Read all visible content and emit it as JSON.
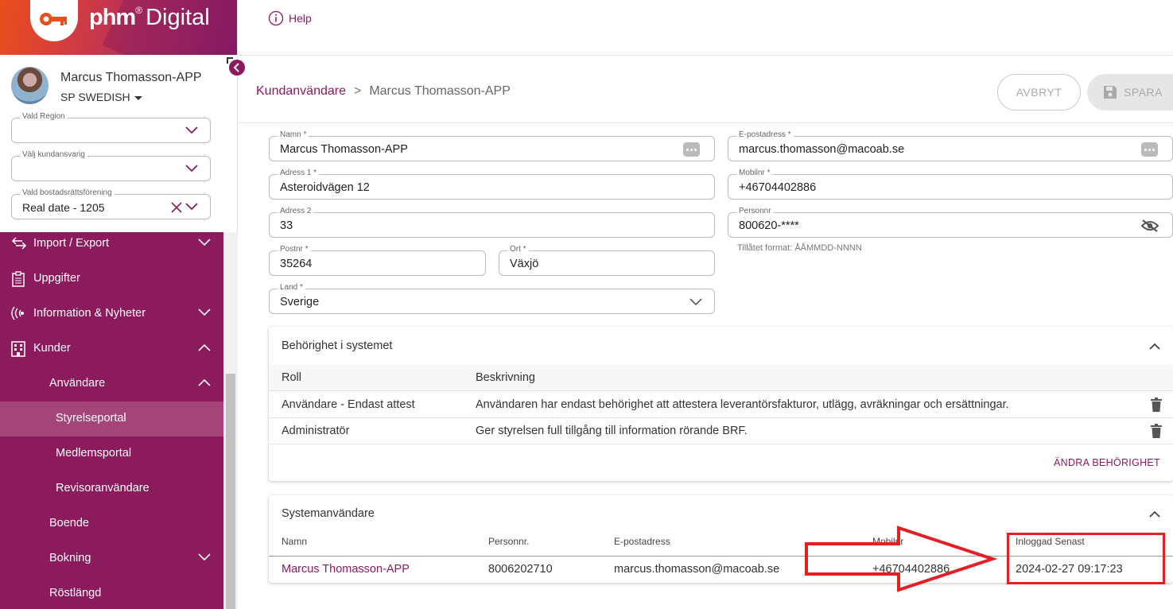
{
  "brand": {
    "name": "phm",
    "suffix": "Digital",
    "sup": "®"
  },
  "user": {
    "name": "Marcus Thomasson-APP",
    "org": "SP SWEDISH"
  },
  "filters": [
    {
      "label": "Vald Region",
      "value": ""
    },
    {
      "label": "Välj kundansvarig",
      "value": ""
    },
    {
      "label": "Vald bostadsrättsförening",
      "value": "Real date - 1205"
    }
  ],
  "nav": {
    "import_export": "Import / Export",
    "tasks": "Uppgifter",
    "info_news": "Information & Nyheter",
    "customers": "Kunder",
    "users": "Användare",
    "board_portal": "Styrelseportal",
    "member_portal": "Medlemsportal",
    "auditor_users": "Revisoranvändare",
    "housing": "Boende",
    "booking": "Bokning",
    "voting_roll": "Röstlängd"
  },
  "topbar": {
    "help": "Help"
  },
  "breadcrumb": {
    "parent": "Kundanvändare",
    "separator": ">",
    "current": "Marcus Thomasson-APP"
  },
  "actions": {
    "cancel": "AVBRYT",
    "save": "SPARA"
  },
  "form": {
    "name": {
      "label": "Namn *",
      "value": "Marcus Thomasson-APP"
    },
    "email": {
      "label": "E-postadress *",
      "value": "marcus.thomasson@macoab.se"
    },
    "address1": {
      "label": "Adress 1 *",
      "value": "Asteroidvägen 12"
    },
    "mobile": {
      "label": "Mobilnr *",
      "value": "+46704402886"
    },
    "address2": {
      "label": "Adress 2",
      "value": "33"
    },
    "personnr": {
      "label": "Personnr",
      "value": "800620-****",
      "hint": "Tillåtet format: ÅÅMMDD-NNNN"
    },
    "postal": {
      "label": "Postnr *",
      "value": "35264"
    },
    "city": {
      "label": "Ort *",
      "value": "Växjö"
    },
    "country": {
      "label": "Land *",
      "value": "Sverige"
    }
  },
  "permissions": {
    "title": "Behörighet i systemet",
    "columns": [
      "Roll",
      "Beskrivning"
    ],
    "rows": [
      {
        "role": "Användare - Endast attest",
        "description": "Användaren har endast behörighet att attestera leverantörsfakturor, utlägg, avräkningar och ersättningar."
      },
      {
        "role": "Administratör",
        "description": "Ger styrelsen full tillgång till information rörande BRF."
      }
    ],
    "change_label": "ÄNDRA BEHÖRIGHET"
  },
  "system_users": {
    "title": "Systemanvändare",
    "columns": [
      "Namn",
      "Personnr.",
      "E-postadress",
      "Mobilnr",
      "Inloggad Senast"
    ],
    "rows": [
      {
        "name": "Marcus Thomasson-APP",
        "personnr": "8006202710",
        "email": "marcus.thomasson@macoab.se",
        "mobile": "+46704402886",
        "last_login": "2024-02-27 09:17:23"
      }
    ]
  },
  "colors": {
    "accent": "#8b1a5e",
    "nav_bg": "#8c1b5d",
    "nav_active": "#a54479",
    "annotation": "#e31e24"
  }
}
